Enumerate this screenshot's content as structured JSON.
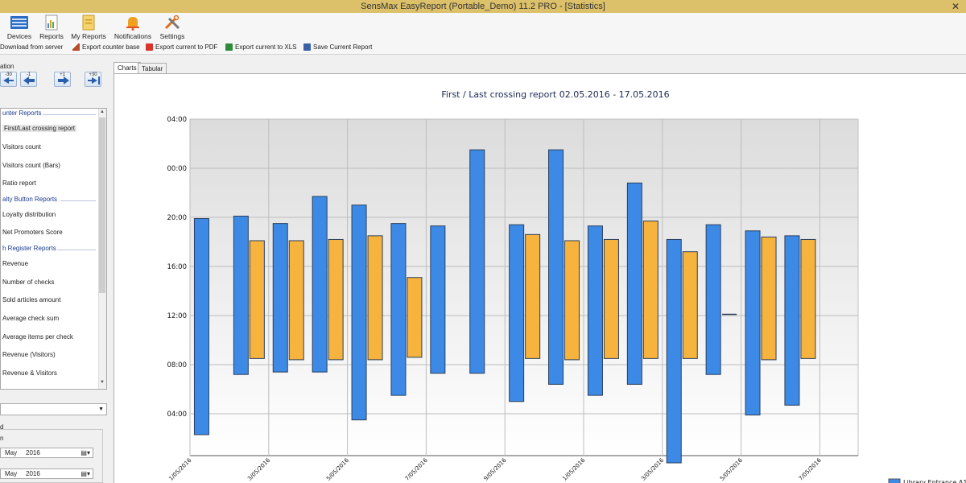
{
  "window": {
    "title": "SensMax EasyReport (Portable_Demo) 11.2 PRO - [Statistics]",
    "close_glyph": "✕"
  },
  "ribbon": [
    {
      "label": "Devices",
      "icon": "devices-icon",
      "color": "#2b6cc4"
    },
    {
      "label": "Reports",
      "icon": "reports-icon",
      "color": "#e0a020"
    },
    {
      "label": "My Reports",
      "icon": "my-reports-icon",
      "color": "#e0a020"
    },
    {
      "label": "Notifications",
      "icon": "notifications-icon",
      "color": "#f0a020"
    },
    {
      "label": "Settings",
      "icon": "settings-icon",
      "color": "#e07020"
    }
  ],
  "toolbar": {
    "download": "Download from server",
    "export_base": "Export counter base",
    "export_pdf": "Export current to PDF",
    "export_xls": "Export current to XLS",
    "save_report": "Save Current Report"
  },
  "sidebar": {
    "nav_label": "ation",
    "nav_buttons": [
      "-30",
      "-1",
      "+1",
      "+30"
    ],
    "groups": [
      {
        "title": "unter Reports",
        "items": [
          "First/Last crossing report",
          "Visitors count",
          "Visitors count (Bars)",
          "Ratio report"
        ]
      },
      {
        "title": "alty Button Reports",
        "items": [
          "Loyalty distribution",
          "Net Promoters Score"
        ]
      },
      {
        "title": "h Register Reports",
        "items": [
          "Revenue",
          "Number of checks",
          "Sold articles amount",
          "Average check sum",
          "Average items per check",
          "Revenue (Visitors)",
          "Revenue & Visitors"
        ]
      }
    ],
    "selected_item": "First/Last crossing report",
    "period_label": "d",
    "from_label": "n",
    "date_from": {
      "month": "May",
      "year": "2016"
    },
    "date_to": {
      "month": "May",
      "year": "2016"
    }
  },
  "tabs": [
    "Charts",
    "Tabular"
  ],
  "active_tab": "Charts",
  "chart_data": {
    "type": "bar",
    "title": "First / Last crossing report 02.05.2016 - 17.05.2016",
    "y_tick_labels": [
      "04:00",
      "00:00",
      "20:00",
      "16:00",
      "12:00",
      "08:00",
      "04:00"
    ],
    "x_tick_labels": [
      "1/05/2016",
      "3/05/2016",
      "5/05/2016",
      "7/05/2016",
      "9/05/2016",
      "1/05/2016",
      "3/05/2016",
      "5/05/2016",
      "7/05/2016"
    ],
    "series": [
      {
        "name": "Library Entrance A1",
        "color": "#3d8ae6",
        "ranges": [
          [
            2.3,
            19.9
          ],
          [
            7.2,
            20.1
          ],
          [
            7.4,
            19.5
          ],
          [
            7.4,
            21.7
          ],
          [
            3.5,
            21.0
          ],
          [
            5.5,
            19.5
          ],
          [
            7.3,
            19.3
          ],
          [
            7.3,
            25.5
          ],
          [
            5.0,
            19.4
          ],
          [
            6.4,
            25.5
          ],
          [
            5.5,
            19.3
          ],
          [
            6.4,
            22.8
          ],
          [
            0.0,
            18.2
          ],
          [
            7.2,
            19.4
          ],
          [
            3.9,
            18.9
          ],
          [
            4.7,
            18.5
          ]
        ]
      },
      {
        "name": "",
        "color": "#f6b33d",
        "ranges": [
          null,
          [
            8.5,
            18.1
          ],
          [
            8.4,
            18.1
          ],
          [
            8.4,
            18.2
          ],
          [
            8.4,
            18.5
          ],
          [
            8.6,
            15.1
          ],
          null,
          null,
          [
            8.5,
            18.6
          ],
          [
            8.4,
            18.1
          ],
          [
            8.5,
            18.2
          ],
          [
            8.5,
            19.7
          ],
          [
            8.5,
            17.2
          ],
          [
            12.1,
            12.1
          ],
          [
            8.4,
            18.4
          ],
          [
            8.5,
            18.2
          ]
        ]
      }
    ],
    "grid": true,
    "legend_position": "bottom-right"
  }
}
